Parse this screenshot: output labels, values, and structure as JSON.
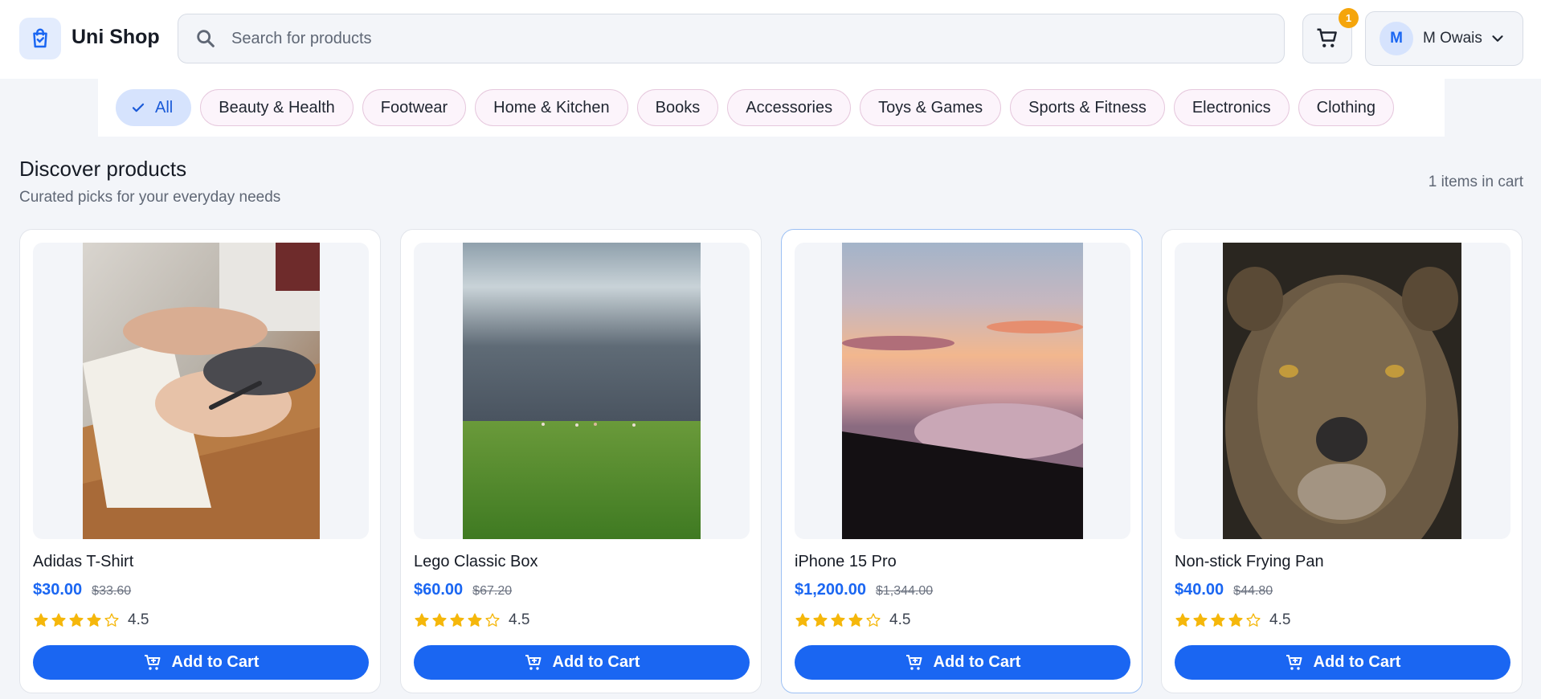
{
  "header": {
    "brand": "Uni Shop",
    "logo_icon": "shopping-bag-icon",
    "search_placeholder": "Search for products",
    "cart_badge": "1",
    "user_initial": "M",
    "user_name": "M Owais"
  },
  "categories": [
    {
      "label": "All",
      "active": true
    },
    {
      "label": "Beauty & Health"
    },
    {
      "label": "Footwear"
    },
    {
      "label": "Home & Kitchen"
    },
    {
      "label": "Books"
    },
    {
      "label": "Accessories"
    },
    {
      "label": "Toys & Games"
    },
    {
      "label": "Sports & Fitness"
    },
    {
      "label": "Electronics"
    },
    {
      "label": "Clothing"
    }
  ],
  "section": {
    "title": "Discover products",
    "subtitle": "Curated picks for your everyday needs",
    "cart_count": "1 items in cart"
  },
  "products": [
    {
      "name": "Adidas T-Shirt",
      "price": "$30.00",
      "old_price": "$33.60",
      "rating": "4.5",
      "button": "Add to Cart",
      "image": "hand-writing-notebook-photo"
    },
    {
      "name": "Lego Classic Box",
      "price": "$60.00",
      "old_price": "$67.20",
      "rating": "4.5",
      "button": "Add to Cart",
      "image": "storm-over-grassland-photo"
    },
    {
      "name": "iPhone 15 Pro",
      "price": "$1,200.00",
      "old_price": "$1,344.00",
      "rating": "4.5",
      "button": "Add to Cart",
      "image": "sunset-above-clouds-photo"
    },
    {
      "name": "Non-stick Frying Pan",
      "price": "$40.00",
      "old_price": "$44.80",
      "rating": "4.5",
      "button": "Add to Cart",
      "image": "lioness-portrait-photo"
    }
  ],
  "colors": {
    "accent": "#1a66f2",
    "badge": "#f5a50b",
    "star": "#f5b70b",
    "page_bg": "#f3f5f9"
  }
}
